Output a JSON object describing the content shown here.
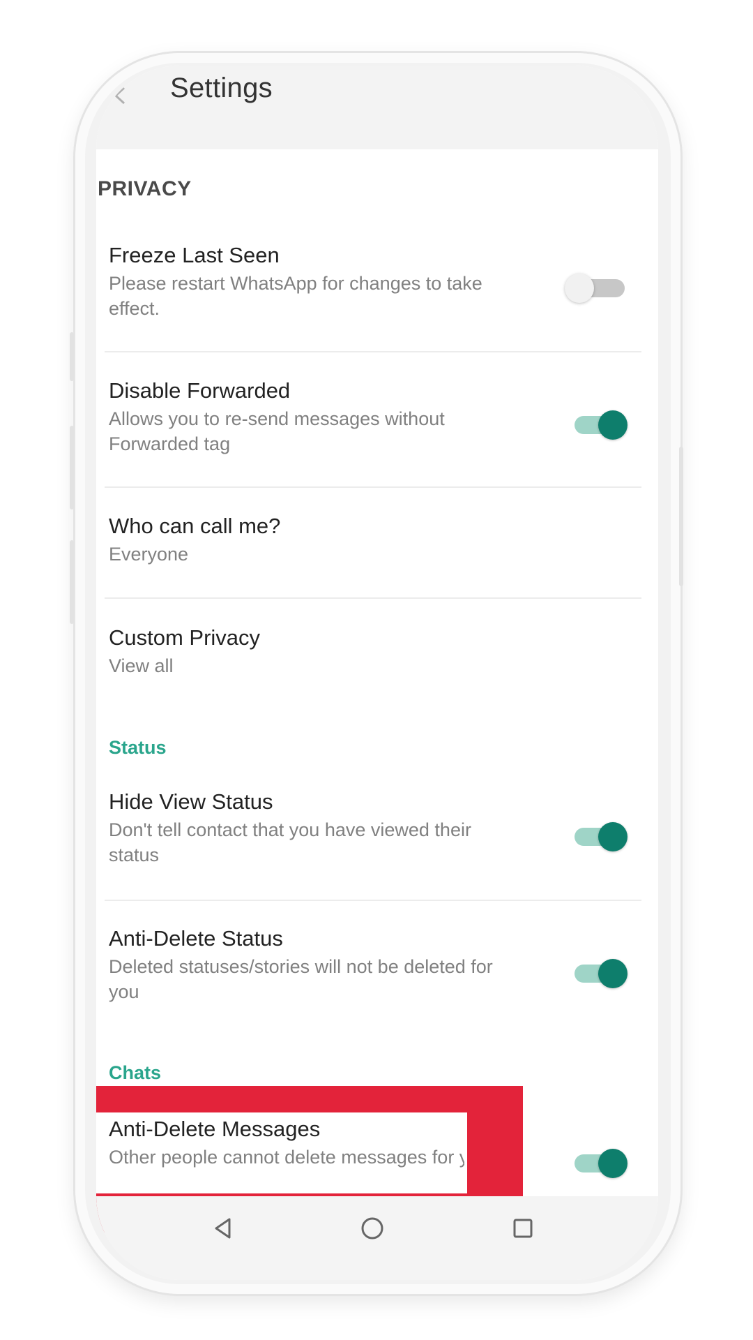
{
  "header": {
    "title": "Settings"
  },
  "privacy": {
    "section_title": "PRIVACY",
    "items": [
      {
        "title": "Freeze Last Seen",
        "subtitle": "Please restart WhatsApp for changes to take effect.",
        "toggle": "off"
      },
      {
        "title": "Disable Forwarded",
        "subtitle": "Allows you to re-send messages without Forwarded tag",
        "toggle": "on"
      },
      {
        "title": "Who can call me?",
        "subtitle": "Everyone"
      },
      {
        "title": "Custom Privacy",
        "subtitle": "View all"
      }
    ]
  },
  "status": {
    "label": "Status",
    "items": [
      {
        "title": "Hide View Status",
        "subtitle": "Don't tell contact that you have viewed their status",
        "toggle": "on"
      },
      {
        "title": "Anti-Delete Status",
        "subtitle": "Deleted statuses/stories will not be deleted for you",
        "toggle": "on"
      }
    ]
  },
  "chats": {
    "label": "Chats",
    "items": [
      {
        "title": "Anti-Delete Messages",
        "subtitle": "Other people cannot delete messages for you",
        "toggle": "on"
      }
    ]
  },
  "colors": {
    "accent": "#0e7e6c",
    "accent_track": "#9fd4c7",
    "category_label": "#2aa58c",
    "highlight": "#e3233a"
  },
  "icons": {
    "back": "arrow-left-icon",
    "nav_back": "triangle-back-icon",
    "nav_home": "circle-home-icon",
    "nav_recents": "square-recents-icon"
  }
}
